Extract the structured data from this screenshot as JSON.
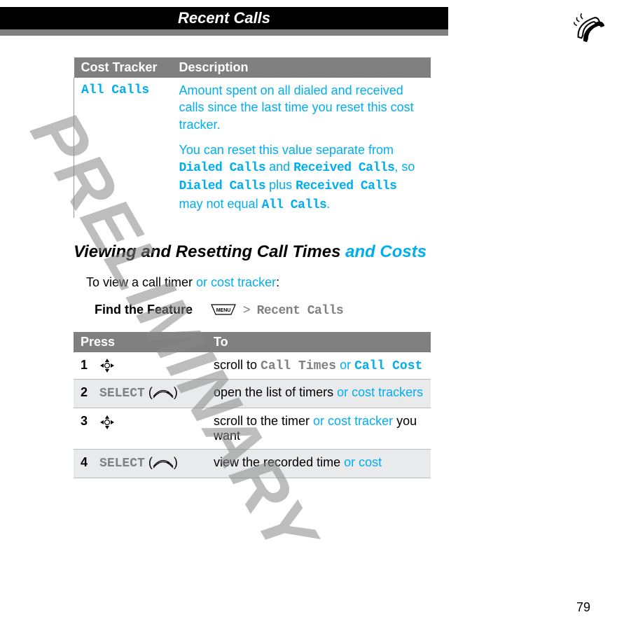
{
  "header": {
    "title": "Recent Calls"
  },
  "watermark": "PRELIMINARY",
  "cost_tracker_table": {
    "head": {
      "col1": "Cost Tracker",
      "col2": "Description"
    },
    "row": {
      "label": "All Calls",
      "para1": "Amount spent on all dialed and received calls since the last time you reset this cost tracker.",
      "p2_a": "You can reset this value separate from ",
      "p2_b": "Dialed Calls",
      "p2_c": " and ",
      "p2_d": "Received Calls",
      "p2_e": ", so ",
      "p2_f": "Dialed Calls",
      "p2_g": " plus ",
      "p2_h": "Received Calls",
      "p2_i": " may not equal ",
      "p2_j": "All Calls",
      "p2_k": "."
    }
  },
  "section": {
    "title_black": "Viewing and Resetting Call Times ",
    "title_cyan": "and Costs",
    "body_black": "To view a call timer ",
    "body_cyan": "or cost tracker",
    "body_colon": ":"
  },
  "find": {
    "label": "Find the Feature",
    "menu_key": "MENU",
    "gt": ">",
    "path": "Recent Calls"
  },
  "press_table": {
    "head": {
      "col1": "Press",
      "col2": "To"
    },
    "rows": [
      {
        "num": "1",
        "press_type": "nav",
        "to_a": "scroll to ",
        "to_b": "Call Times",
        "to_c": " or ",
        "to_d": "Call Cost"
      },
      {
        "num": "2",
        "press_type": "select",
        "select_label": "SELECT",
        "to_a": "open the list of timers ",
        "to_b": "or cost trackers"
      },
      {
        "num": "3",
        "press_type": "nav",
        "to_a": "scroll to the timer ",
        "to_b": "or cost tracker",
        "to_c": " you want"
      },
      {
        "num": "4",
        "press_type": "select",
        "select_label": "SELECT",
        "to_a": "view the recorded time ",
        "to_b": "or cost"
      }
    ]
  },
  "page_number": "79"
}
